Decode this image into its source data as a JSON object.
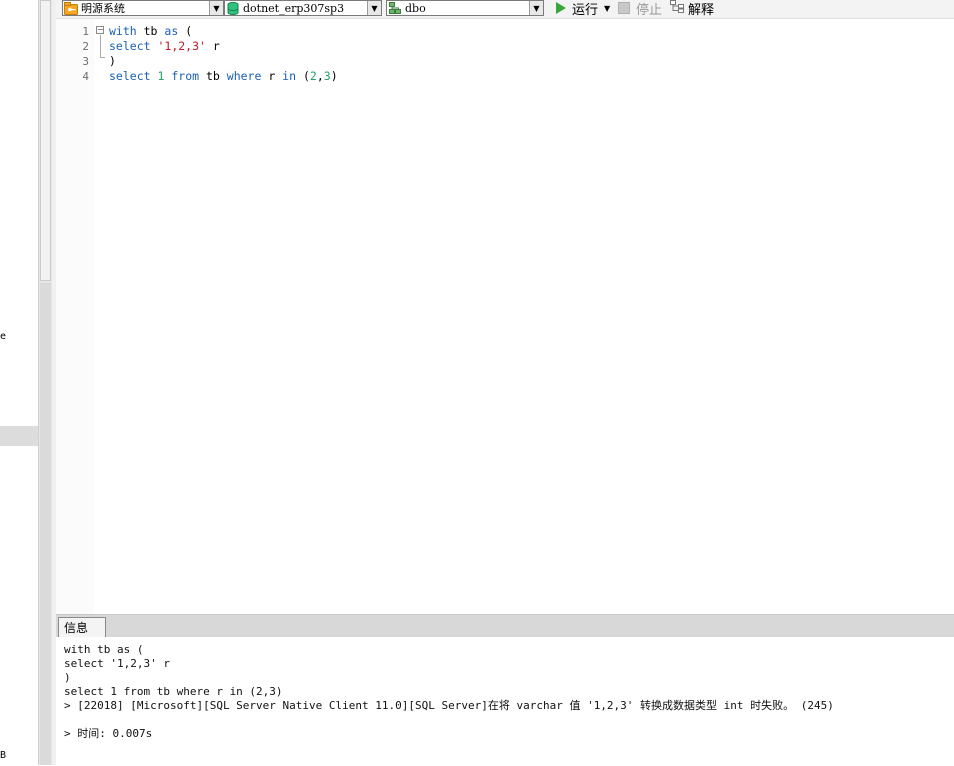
{
  "toolbar": {
    "connection": {
      "icon": "folder-key-icon",
      "value": "明源系统"
    },
    "database": {
      "icon": "database-icon",
      "value": "dotnet_erp307sp3"
    },
    "schema": {
      "icon": "schema-icon",
      "value": "dbo"
    },
    "run_label": "运行",
    "stop_label": "停止",
    "explain_label": "解释"
  },
  "left_fragments": {
    "frag1": "e",
    "frag2": "B"
  },
  "editor": {
    "lines": [
      {
        "num": "1",
        "tokens": [
          "with",
          " tb ",
          "as",
          " ("
        ]
      },
      {
        "num": "2",
        "tokens": [
          "select",
          " ",
          "'1,2,3'",
          " r"
        ]
      },
      {
        "num": "3",
        "tokens": [
          ")"
        ]
      },
      {
        "num": "4",
        "tokens": [
          "select",
          " ",
          "1",
          " ",
          "from",
          " tb ",
          "where",
          " r ",
          "in",
          " (",
          "2",
          ",",
          "3",
          ")"
        ]
      }
    ]
  },
  "messages": {
    "tab_label": "信息",
    "lines": [
      "with tb as (",
      "select '1,2,3' r",
      ")",
      "select 1 from tb where r in (2,3)",
      "> [22018] [Microsoft][SQL Server Native Client 11.0][SQL Server]在将 varchar 值 '1,2,3' 转换成数据类型 int 时失败。 (245)",
      "",
      "> 时间: 0.007s"
    ]
  },
  "colors": {
    "keyword": "#1a5fb4",
    "string": "#c01c28",
    "number": "#26a269",
    "run": "#3aa63a"
  }
}
